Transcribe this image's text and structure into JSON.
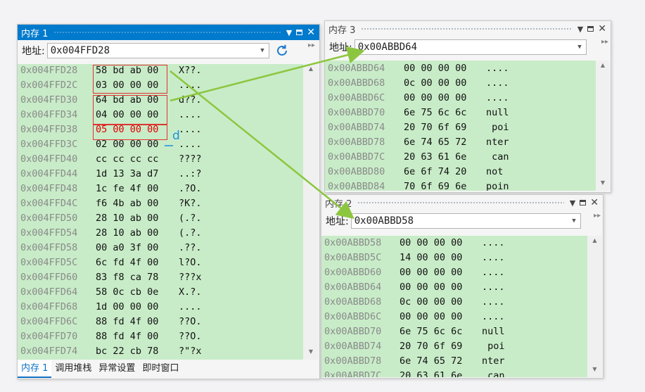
{
  "panel1": {
    "title": "内存 1",
    "address_label": "地址:",
    "address_value": "0x004FFD28",
    "rows": [
      {
        "addr": "0x004FFD28",
        "bytes": "58 bd ab 00",
        "ascii": "X??."
      },
      {
        "addr": "0x004FFD2C",
        "bytes": "03 00 00 00",
        "ascii": "...."
      },
      {
        "addr": "0x004FFD30",
        "bytes": "64 bd ab 00",
        "ascii": "d??."
      },
      {
        "addr": "0x004FFD34",
        "bytes": "04 00 00 00",
        "ascii": "...."
      },
      {
        "addr": "0x004FFD38",
        "bytes": "05 00 00 00",
        "ascii": "...."
      },
      {
        "addr": "0x004FFD3C",
        "bytes": "02 00 00 00",
        "ascii": "...."
      },
      {
        "addr": "0x004FFD40",
        "bytes": "cc cc cc cc",
        "ascii": "????"
      },
      {
        "addr": "0x004FFD44",
        "bytes": "1d 13 3a d7",
        "ascii": "..:?"
      },
      {
        "addr": "0x004FFD48",
        "bytes": "1c fe 4f 00",
        "ascii": ".?O."
      },
      {
        "addr": "0x004FFD4C",
        "bytes": "f6 4b ab 00",
        "ascii": "?K?."
      },
      {
        "addr": "0x004FFD50",
        "bytes": "28 10 ab 00",
        "ascii": "(.?."
      },
      {
        "addr": "0x004FFD54",
        "bytes": "28 10 ab 00",
        "ascii": "(.?."
      },
      {
        "addr": "0x004FFD58",
        "bytes": "00 a0 3f 00",
        "ascii": ".??."
      },
      {
        "addr": "0x004FFD5C",
        "bytes": "6c fd 4f 00",
        "ascii": "l?O."
      },
      {
        "addr": "0x004FFD60",
        "bytes": "83 f8 ca 78",
        "ascii": "???x"
      },
      {
        "addr": "0x004FFD64",
        "bytes": "58 0c cb 0e",
        "ascii": "X.?."
      },
      {
        "addr": "0x004FFD68",
        "bytes": "1d 00 00 00",
        "ascii": "...."
      },
      {
        "addr": "0x004FFD6C",
        "bytes": "88 fd 4f 00",
        "ascii": "??O."
      },
      {
        "addr": "0x004FFD70",
        "bytes": "88 fd 4f 00",
        "ascii": "??O."
      },
      {
        "addr": "0x004FFD74",
        "bytes": "bc 22 cb 78",
        "ascii": "?\"?x"
      }
    ],
    "tabs": [
      "内存 1",
      "调用堆栈",
      "异常设置",
      "即时窗口"
    ],
    "annotation": "d"
  },
  "panel3": {
    "title": "内存 3",
    "address_label": "地址:",
    "address_value": "0x00ABBD64",
    "rows": [
      {
        "addr": "0x00ABBD64",
        "bytes": "00 00 00 00",
        "ascii": "...."
      },
      {
        "addr": "0x00ABBD68",
        "bytes": "0c 00 00 00",
        "ascii": "...."
      },
      {
        "addr": "0x00ABBD6C",
        "bytes": "00 00 00 00",
        "ascii": "...."
      },
      {
        "addr": "0x00ABBD70",
        "bytes": "6e 75 6c 6c",
        "ascii": "null"
      },
      {
        "addr": "0x00ABBD74",
        "bytes": "20 70 6f 69",
        "ascii": " poi"
      },
      {
        "addr": "0x00ABBD78",
        "bytes": "6e 74 65 72",
        "ascii": "nter"
      },
      {
        "addr": "0x00ABBD7C",
        "bytes": "20 63 61 6e",
        "ascii": " can"
      },
      {
        "addr": "0x00ABBD80",
        "bytes": "6e 6f 74 20",
        "ascii": "not "
      },
      {
        "addr": "0x00ABBD84",
        "bytes": "70 6f 69 6e",
        "ascii": "poin"
      }
    ]
  },
  "panel2": {
    "title": "内存 2",
    "address_label": "地址:",
    "address_value": "0x00ABBD58",
    "rows": [
      {
        "addr": "0x00ABBD58",
        "bytes": "00 00 00 00",
        "ascii": "...."
      },
      {
        "addr": "0x00ABBD5C",
        "bytes": "14 00 00 00",
        "ascii": "...."
      },
      {
        "addr": "0x00ABBD60",
        "bytes": "00 00 00 00",
        "ascii": "...."
      },
      {
        "addr": "0x00ABBD64",
        "bytes": "00 00 00 00",
        "ascii": "...."
      },
      {
        "addr": "0x00ABBD68",
        "bytes": "0c 00 00 00",
        "ascii": "...."
      },
      {
        "addr": "0x00ABBD6C",
        "bytes": "00 00 00 00",
        "ascii": "...."
      },
      {
        "addr": "0x00ABBD70",
        "bytes": "6e 75 6c 6c",
        "ascii": "null"
      },
      {
        "addr": "0x00ABBD74",
        "bytes": "20 70 6f 69",
        "ascii": " poi"
      },
      {
        "addr": "0x00ABBD78",
        "bytes": "6e 74 65 72",
        "ascii": "nter"
      },
      {
        "addr": "0x00ABBD7C",
        "bytes": "20 63 61 6e",
        "ascii": " can"
      }
    ]
  },
  "colors": {
    "accent": "#007acc",
    "memory_bg": "#c8ecc8",
    "arrow": "#8cc63f",
    "highlight_box": "#dd3333",
    "changed_value": "#e00000"
  }
}
